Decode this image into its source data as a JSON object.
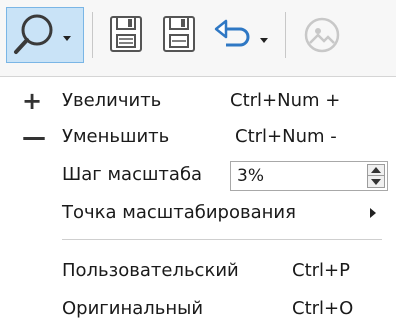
{
  "toolbar": {
    "buttons": [
      {
        "icon": "zoom-search-icon",
        "active": true
      },
      {
        "icon": "save-icon"
      },
      {
        "icon": "save-as-icon"
      },
      {
        "icon": "undo-icon"
      },
      {
        "icon": "disabled-picture-icon"
      }
    ]
  },
  "menu": {
    "zoom_in": {
      "icon": "plus",
      "label": "Увеличить",
      "shortcut": "Ctrl+Num +"
    },
    "zoom_out": {
      "icon": "minus",
      "label": "Уменьшить",
      "shortcut": "Ctrl+Num -"
    },
    "zoom_step": {
      "label": "Шаг масштаба",
      "value": "3%"
    },
    "zoom_point": {
      "label": "Точка масштабирования"
    },
    "custom": {
      "label": "Пользовательский",
      "shortcut": "Ctrl+P"
    },
    "original": {
      "label": "Оригинальный",
      "shortcut": "Ctrl+O"
    }
  },
  "colors": {
    "active_button_bg": "#c9e3f7",
    "active_button_border": "#7ab6e6",
    "icon_blue": "#2f78c4"
  }
}
